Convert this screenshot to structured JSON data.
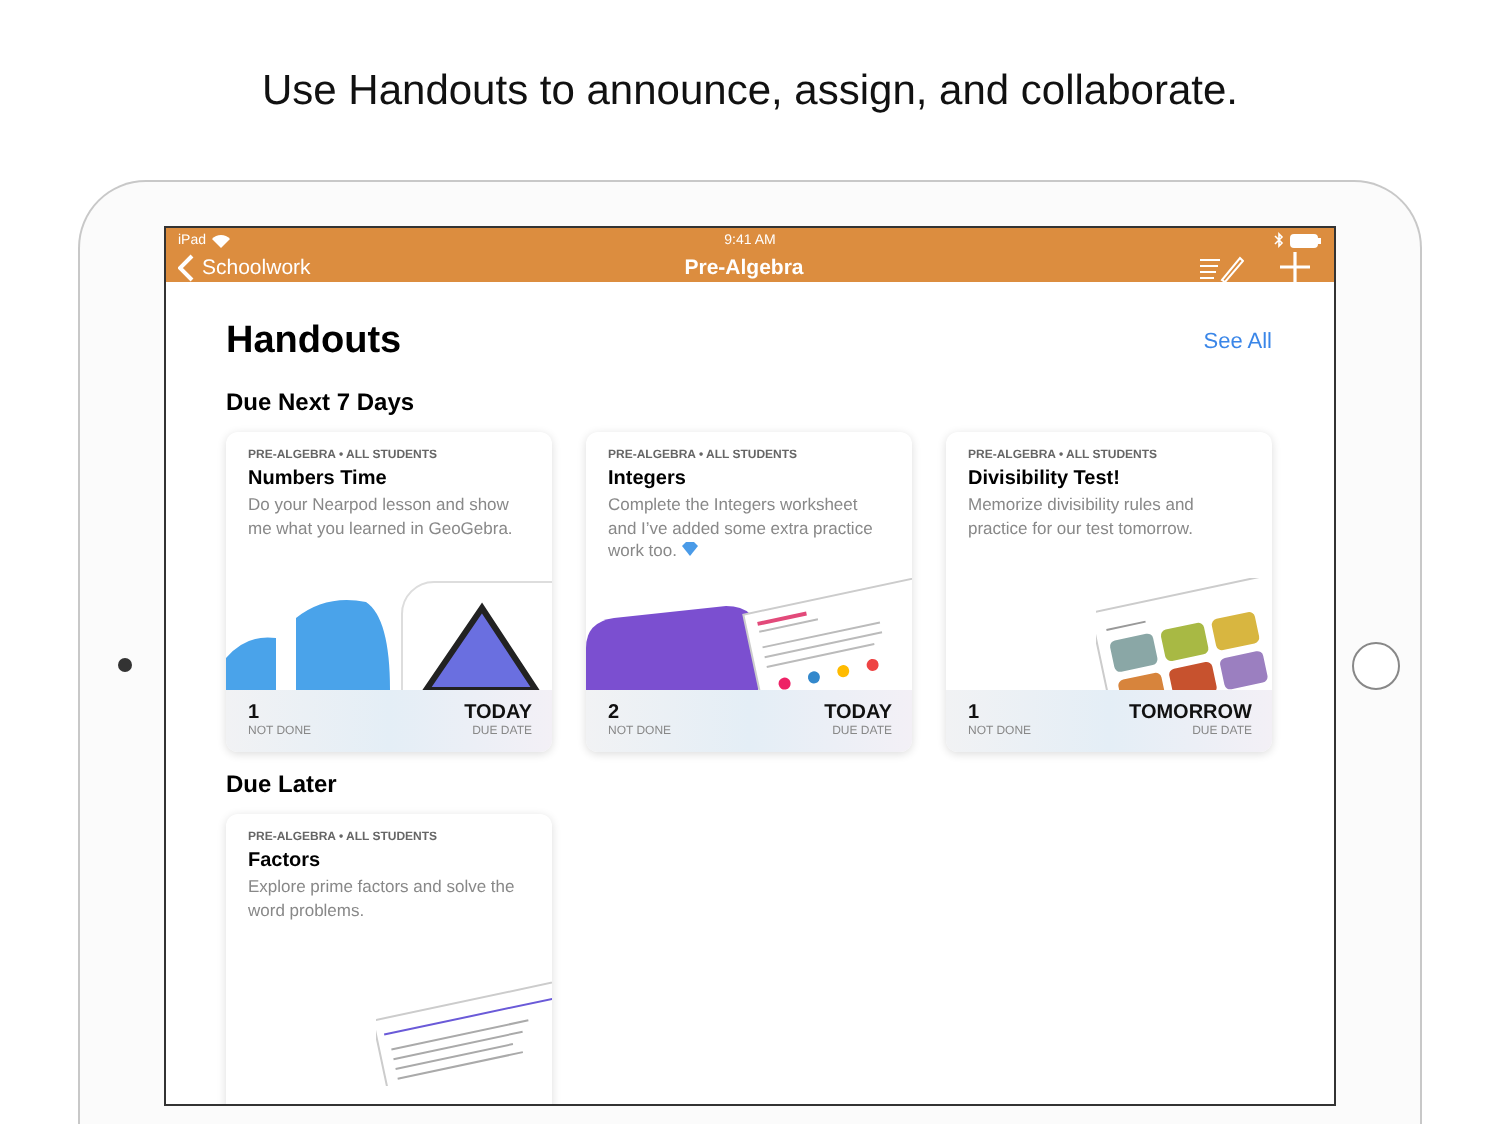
{
  "headline": "Use Handouts to announce, assign, and collaborate.",
  "status_bar": {
    "carrier": "iPad",
    "time": "9:41 AM"
  },
  "nav": {
    "back_label": "Schoolwork",
    "title": "Pre-Algebra"
  },
  "page": {
    "title": "Handouts",
    "see_all": "See All"
  },
  "sections": [
    {
      "title": "Due Next 7 Days",
      "cards": [
        {
          "meta": "PRE-ALGEBRA • ALL STUDENTS",
          "title": "Numbers Time",
          "description": "Do your Nearpod lesson and show me what you learned in GeoGebra.",
          "gem": false,
          "kind": "app-icons",
          "count": "1",
          "count_label": "NOT DONE",
          "due": "TODAY",
          "due_label": "DUE DATE"
        },
        {
          "meta": "PRE-ALGEBRA • ALL STUDENTS",
          "title": "Integers",
          "description": "Complete the Integers worksheet and I’ve added some extra practice work too.",
          "gem": true,
          "kind": "app-worksheet",
          "count": "2",
          "count_label": "NOT DONE",
          "due": "TODAY",
          "due_label": "DUE DATE"
        },
        {
          "meta": "PRE-ALGEBRA • ALL STUDENTS",
          "title": "Divisibility Test!",
          "description": "Memorize divisibility rules and practice for our test tomorrow.",
          "gem": false,
          "kind": "tiles",
          "count": "1",
          "count_label": "NOT DONE",
          "due": "TOMORROW",
          "due_label": "DUE DATE"
        }
      ]
    },
    {
      "title": "Due Later",
      "cards": [
        {
          "meta": "PRE-ALGEBRA • ALL STUDENTS",
          "title": "Factors",
          "description": "Explore prime factors and solve the word problems.",
          "gem": false,
          "kind": "worksheet"
        }
      ]
    }
  ]
}
